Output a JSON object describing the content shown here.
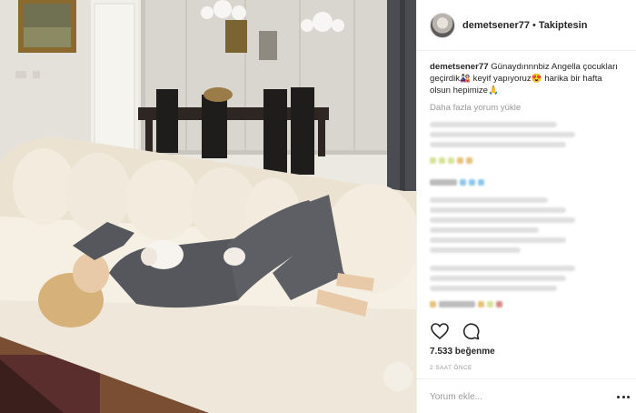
{
  "post": {
    "username": "demetsener77",
    "separator": "•",
    "follow_status": "Takiptesin",
    "caption_user": "demetsener77",
    "caption_text": " Günaydınnnbiz Angella çocukları geçirdik🎎 keyif yapıyoruz😍 harika bir hafta olsun hepimize🙏",
    "load_more": "Daha fazla yorum yükle",
    "likes": "7.533 beğenme",
    "time": "2 SAAT ÖNCE",
    "comment_placeholder": "Yorum ekle..."
  },
  "icons": {
    "like": "heart-outline-icon",
    "comment": "speech-bubble-icon",
    "more": "more-options-icon"
  },
  "colors": {
    "text": "#262626",
    "muted": "#999999",
    "border": "#efefef"
  }
}
